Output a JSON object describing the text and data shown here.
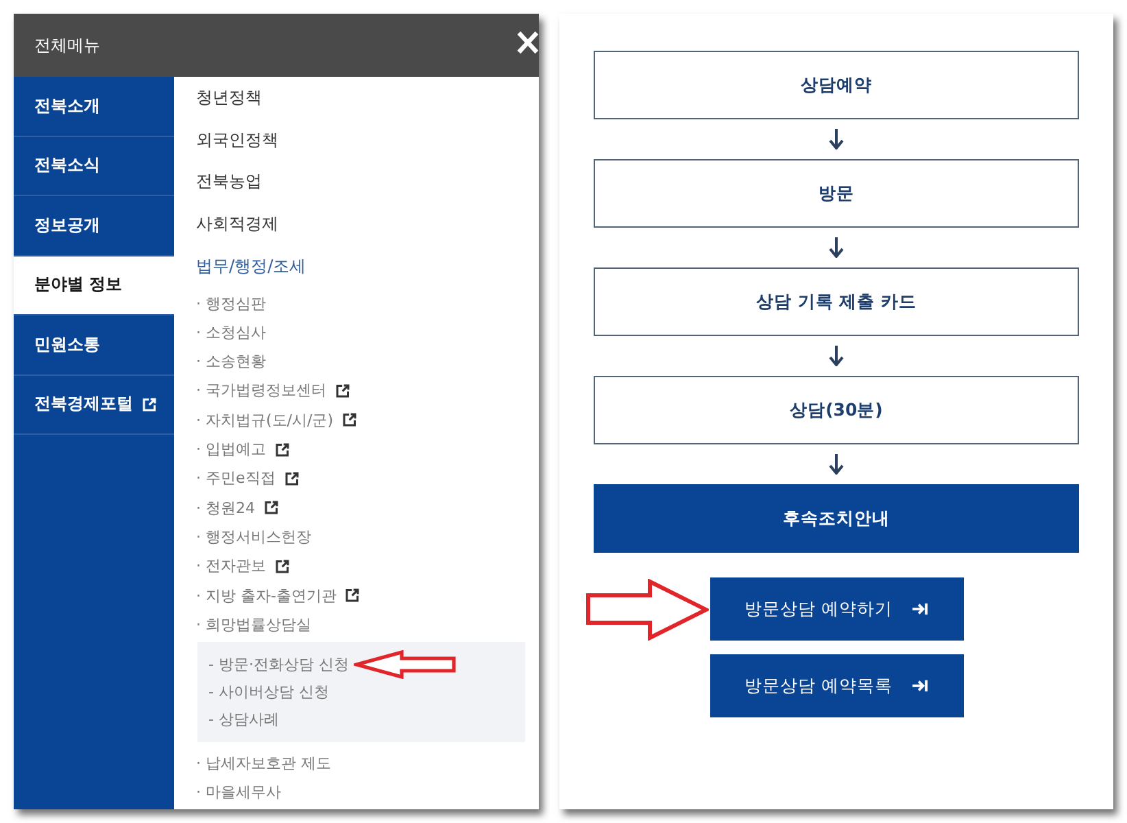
{
  "menu_panel": {
    "title": "전체메뉴",
    "sidebar": [
      {
        "label": "전북소개",
        "selected": false,
        "external": false
      },
      {
        "label": "전북소식",
        "selected": false,
        "external": false
      },
      {
        "label": "정보공개",
        "selected": false,
        "external": false
      },
      {
        "label": "분야별 정보",
        "selected": true,
        "external": false
      },
      {
        "label": "민원소통",
        "selected": false,
        "external": false
      },
      {
        "label": "전북경제포털",
        "selected": false,
        "external": true
      }
    ],
    "items": [
      {
        "label": "청년정책",
        "expanded": false
      },
      {
        "label": "외국인정책",
        "expanded": false
      },
      {
        "label": "전북농업",
        "expanded": false
      },
      {
        "label": "사회적경제",
        "expanded": false
      },
      {
        "label": "법무/행정/조세",
        "expanded": true,
        "children": [
          {
            "label": "· 행정심판",
            "external": false
          },
          {
            "label": "· 소청심사",
            "external": false
          },
          {
            "label": "· 소송현황",
            "external": false
          },
          {
            "label": "· 국가법령정보센터",
            "external": true
          },
          {
            "label": "· 자치법규(도/시/군)",
            "external": true
          },
          {
            "label": "· 입법예고",
            "external": true
          },
          {
            "label": "· 주민e직접",
            "external": true
          },
          {
            "label": "· 청원24",
            "external": true
          },
          {
            "label": "· 행정서비스헌장",
            "external": false
          },
          {
            "label": "· 전자관보",
            "external": true
          },
          {
            "label": "· 지방 출자-출연기관",
            "external": true
          },
          {
            "label": "· 희망법률상담실",
            "external": false,
            "children": [
              {
                "label": "- 방문·전화상담 신청",
                "marked": true
              },
              {
                "label": "- 사이버상담 신청",
                "marked": false
              },
              {
                "label": "- 상담사례",
                "marked": false
              }
            ]
          },
          {
            "label": "· 납세자보호관 제도",
            "external": false
          },
          {
            "label": "· 마을세무사",
            "external": false
          }
        ]
      }
    ]
  },
  "flow_panel": {
    "steps": [
      {
        "label": "상담예약",
        "kind": "outline"
      },
      {
        "label": "방문",
        "kind": "outline"
      },
      {
        "label": "상담 기록 제출 카드",
        "kind": "outline"
      },
      {
        "label": "상담(30분)",
        "kind": "outline"
      },
      {
        "label": "후속조치안내",
        "kind": "solid"
      }
    ],
    "buttons": [
      {
        "label": "방문상담 예약하기",
        "marked": true
      },
      {
        "label": "방문상담 예약목록",
        "marked": false
      }
    ]
  }
}
